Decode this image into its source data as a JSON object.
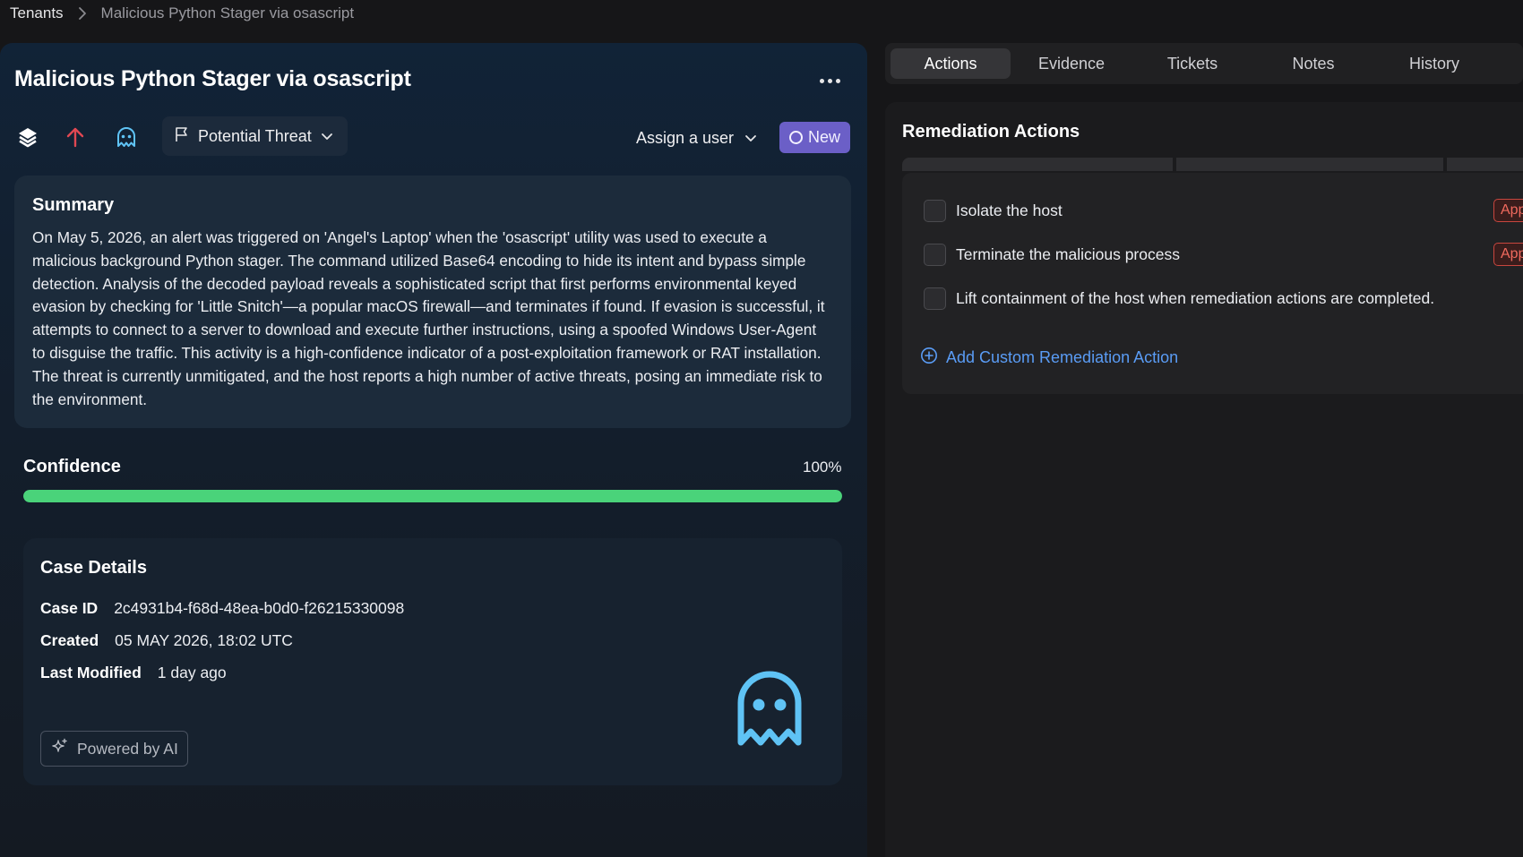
{
  "breadcrumb": {
    "root": "Tenants",
    "current": "Malicious Python Stager via osascript"
  },
  "case": {
    "title": "Malicious Python Stager via osascript",
    "classification": "Potential Threat",
    "assign_label": "Assign a user",
    "status": "New",
    "summary_title": "Summary",
    "summary_text": "On May 5, 2026, an alert was triggered on 'Angel's Laptop' when the 'osascript' utility was used to execute a malicious background Python stager. The command utilized Base64 encoding to hide its intent and bypass simple detection. Analysis of the decoded payload reveals a sophisticated script that first performs environmental keyed evasion by checking for 'Little Snitch'—a popular macOS firewall—and terminates if found. If evasion is successful, it attempts to connect to a server to download and execute further instructions, using a spoofed Windows User-Agent to disguise the traffic. This activity is a high-confidence indicator of a post-exploitation framework or RAT installation. The threat is currently unmitigated, and the host reports a high number of active threats, posing an immediate risk to the environment.",
    "confidence_label": "Confidence",
    "confidence_value": "100%",
    "confidence_fraction": 1.0
  },
  "details": {
    "title": "Case Details",
    "rows": [
      {
        "key": "Case ID",
        "value": "2c4931b4-f68d-48ea-b0d0-f26215330098"
      },
      {
        "key": "Created",
        "value": "05 MAY 2026, 18:02 UTC"
      },
      {
        "key": "Last Modified",
        "value": "1 day ago"
      }
    ],
    "powered_by": "Powered by AI"
  },
  "tabs": [
    "Actions",
    "Evidence",
    "Tickets",
    "Notes",
    "History"
  ],
  "active_tab": "Actions",
  "remediation": {
    "title": "Remediation Actions",
    "items": [
      {
        "label": "Isolate the host",
        "tag": "App"
      },
      {
        "label": "Terminate the malicious process",
        "tag": "App"
      },
      {
        "label": "Lift containment of the host when remediation actions are completed.",
        "tag": ""
      }
    ],
    "add_label": "Add Custom Remediation Action"
  },
  "colors": {
    "accent_blue": "#5a9cf5",
    "status_new": "#6b5fc7",
    "confidence_green": "#4ad37a",
    "priority_red": "#e04852",
    "ghost_blue": "#5fc3f5"
  },
  "icons": {
    "toolbar": [
      "layers-logo-icon",
      "arrow-up-icon",
      "ghost-icon"
    ],
    "threat": "flag-icon",
    "chevron": "chevron-down-icon",
    "powered": "sparkle-icon",
    "add": "plus-circle-icon"
  }
}
